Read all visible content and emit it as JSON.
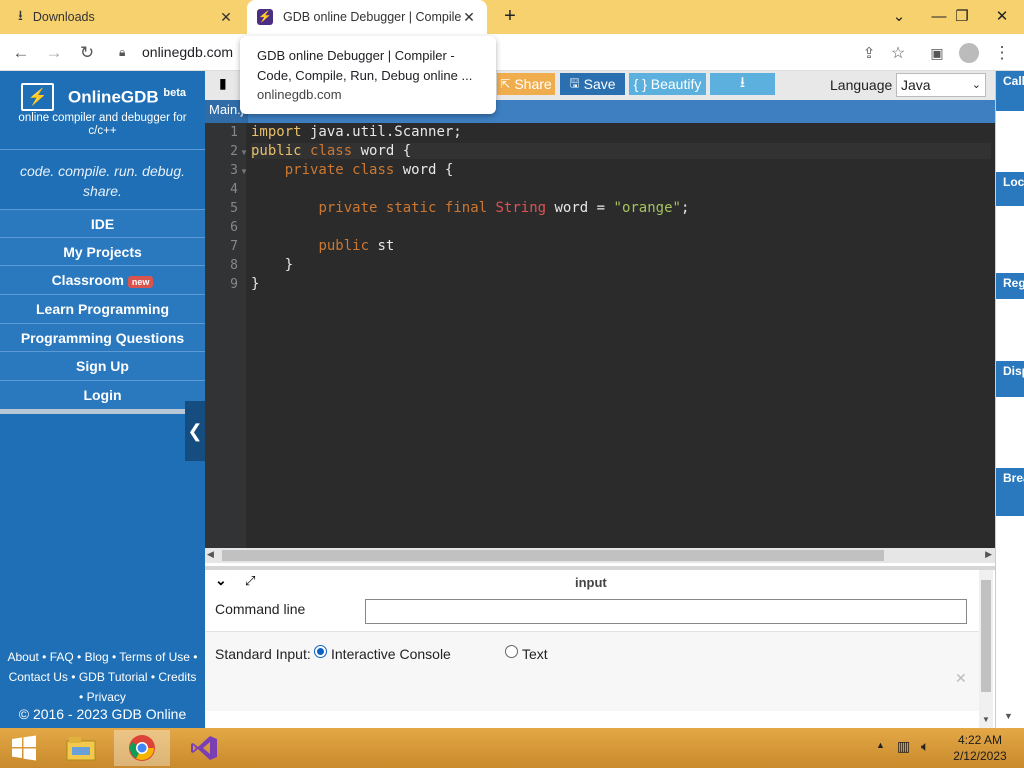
{
  "browser": {
    "tabs": [
      {
        "title": "Downloads",
        "close": "✕"
      },
      {
        "title": "GDB online Debugger | Compiler - Code, Compile, Run, Debug online C, C++",
        "close": "✕"
      }
    ],
    "new_tab": "+",
    "url": "onlinegdb.com",
    "tooltip": {
      "title": "GDB online Debugger | Compiler - Code, Compile, Run, Debug online ...",
      "url": "onlinegdb.com"
    }
  },
  "sidebar": {
    "brand": "OnlineGDB",
    "brand_sup": "beta",
    "subtitle": "online compiler and debugger for c/c++",
    "slogan": "code. compile. run. debug. share.",
    "items": [
      {
        "label": "IDE"
      },
      {
        "label": "My Projects"
      },
      {
        "label": "Classroom",
        "badge": "new"
      },
      {
        "label": "Learn Programming"
      },
      {
        "label": "Programming Questions"
      },
      {
        "label": "Sign Up"
      },
      {
        "label": "Login"
      }
    ],
    "footer": {
      "about": "About",
      "faq": "FAQ",
      "blog": "Blog",
      "terms": "Terms of Use",
      "contact": "Contact Us",
      "tutorial": "GDB Tutorial",
      "credits": "Credits",
      "privacy": "Privacy"
    },
    "copyright": "© 2016 - 2023 GDB Online"
  },
  "toolbar": {
    "share": "Share",
    "save": "Save",
    "beautify": "{ } Beautify",
    "language_label": "Language",
    "language_value": "Java"
  },
  "file_tab": "Main.j",
  "editor": {
    "line_numbers": [
      "1",
      "2",
      "3",
      "4",
      "5",
      "6",
      "7",
      "8",
      "9"
    ],
    "lines": {
      "l1_kw": "import",
      "l1_rest": " java.util.Scanner;",
      "l2_kw1": "public",
      "l2_kw2": "class",
      "l2_rest": " word {",
      "l3_kw1": "private",
      "l3_kw2": "class",
      "l3_rest": " word {",
      "l5_kw1": "private",
      "l5_kw2": "static",
      "l5_kw3": "final",
      "l5_type": "String",
      "l5_mid": " word = ",
      "l5_str": "\"orange\"",
      "l5_end": ";",
      "l7_kw": "public",
      "l7_rest": " st",
      "l8": "}",
      "l9": "}"
    }
  },
  "input_pane": {
    "title": "input",
    "command_line_label": "Command line",
    "stdin_label": "Standard Input:",
    "opt_interactive": "Interactive Console",
    "opt_text": "Text"
  },
  "right_panel": [
    "Call Stack",
    "Local Variables",
    "Registers",
    "Display Expressions",
    "Breakpoints and Watchpoints"
  ],
  "taskbar": {
    "time": "4:22 AM",
    "date": "2/12/2023"
  }
}
